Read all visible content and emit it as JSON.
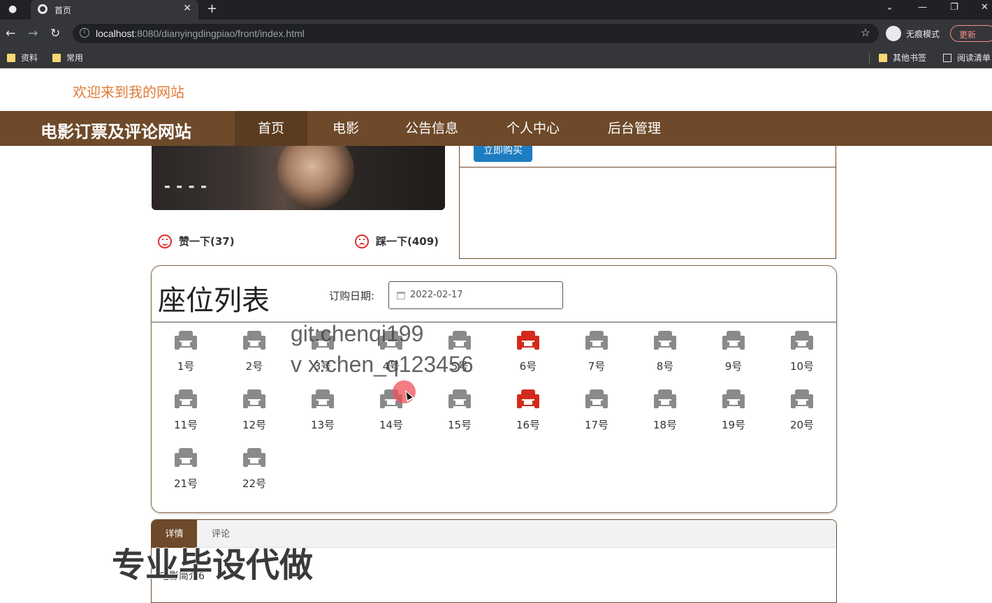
{
  "browser": {
    "tab_title": "首页",
    "url_host": "localhost",
    "url_rest": ":8080/dianyingdingpiao/front/index.html",
    "incognito_label": "无痕模式",
    "update_label": "更新",
    "bookmarks": [
      "资料",
      "常用"
    ],
    "other_bookmarks": "其他书签",
    "reading_list": "阅读清单"
  },
  "page": {
    "welcome": "欢迎来到我的网站",
    "site_title": "电影订票及评论网站",
    "nav": [
      "首页",
      "电影",
      "公告信息",
      "个人中心",
      "后台管理"
    ],
    "nav_active": "首页",
    "buy_button": "立即购买",
    "like": "赞一下(37)",
    "dislike": "踩一下(409)",
    "seat_heading": "座位列表",
    "date_label": "订购日期:",
    "date_value": "2022-02-17",
    "seats": [
      {
        "label": "1号",
        "sold": false
      },
      {
        "label": "2号",
        "sold": false
      },
      {
        "label": "3号",
        "sold": false
      },
      {
        "label": "4号",
        "sold": false
      },
      {
        "label": "5号",
        "sold": false
      },
      {
        "label": "6号",
        "sold": true
      },
      {
        "label": "7号",
        "sold": false
      },
      {
        "label": "8号",
        "sold": false
      },
      {
        "label": "9号",
        "sold": false
      },
      {
        "label": "10号",
        "sold": false
      },
      {
        "label": "11号",
        "sold": false
      },
      {
        "label": "12号",
        "sold": false
      },
      {
        "label": "13号",
        "sold": false
      },
      {
        "label": "14号",
        "sold": false
      },
      {
        "label": "15号",
        "sold": false
      },
      {
        "label": "16号",
        "sold": true
      },
      {
        "label": "17号",
        "sold": false
      },
      {
        "label": "18号",
        "sold": false
      },
      {
        "label": "19号",
        "sold": false
      },
      {
        "label": "20号",
        "sold": false
      },
      {
        "label": "21号",
        "sold": false
      },
      {
        "label": "22号",
        "sold": false
      }
    ],
    "tabs": [
      "详情",
      "评论"
    ],
    "intro": "电影简介6"
  },
  "overlays": {
    "watermark_line1": "git:chenqi199",
    "watermark_line2": "v x:chen_q123456",
    "banner": "专业毕设代做"
  },
  "colors": {
    "nav_bg": "#6e4a2a",
    "welcome": "#e07b39",
    "sold_seat": "#d42a1c",
    "free_seat": "#8a8a8a",
    "buy_button": "#1e7cc0"
  }
}
